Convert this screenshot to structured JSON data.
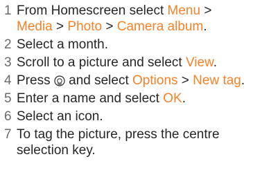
{
  "colors": {
    "text": "#262626",
    "number": "#6a6a6a",
    "highlight": "#f5822a"
  },
  "steps": [
    {
      "number": "1",
      "t1": "From Homescreen select ",
      "m1": "Menu",
      "s1": " > ",
      "m2": "Media",
      "s2": " > ",
      "m3": "Photo",
      "s3": " > ",
      "m4": "Camera album",
      "t2": "."
    },
    {
      "number": "2",
      "text": "Select a month."
    },
    {
      "number": "3",
      "t1": "Scroll to a picture and select ",
      "m1": "View",
      "t2": "."
    },
    {
      "number": "4",
      "t1": "Press ",
      "icon": "navigation-key-icon",
      "t2": " and select ",
      "m1": "Options",
      "s1": " > ",
      "m2": "New tag",
      "t3": "."
    },
    {
      "number": "5",
      "t1": "Enter a name and select ",
      "m1": "OK",
      "t2": "."
    },
    {
      "number": "6",
      "text": "Select an icon."
    },
    {
      "number": "7",
      "text": "To tag the picture, press the centre selection key."
    }
  ]
}
